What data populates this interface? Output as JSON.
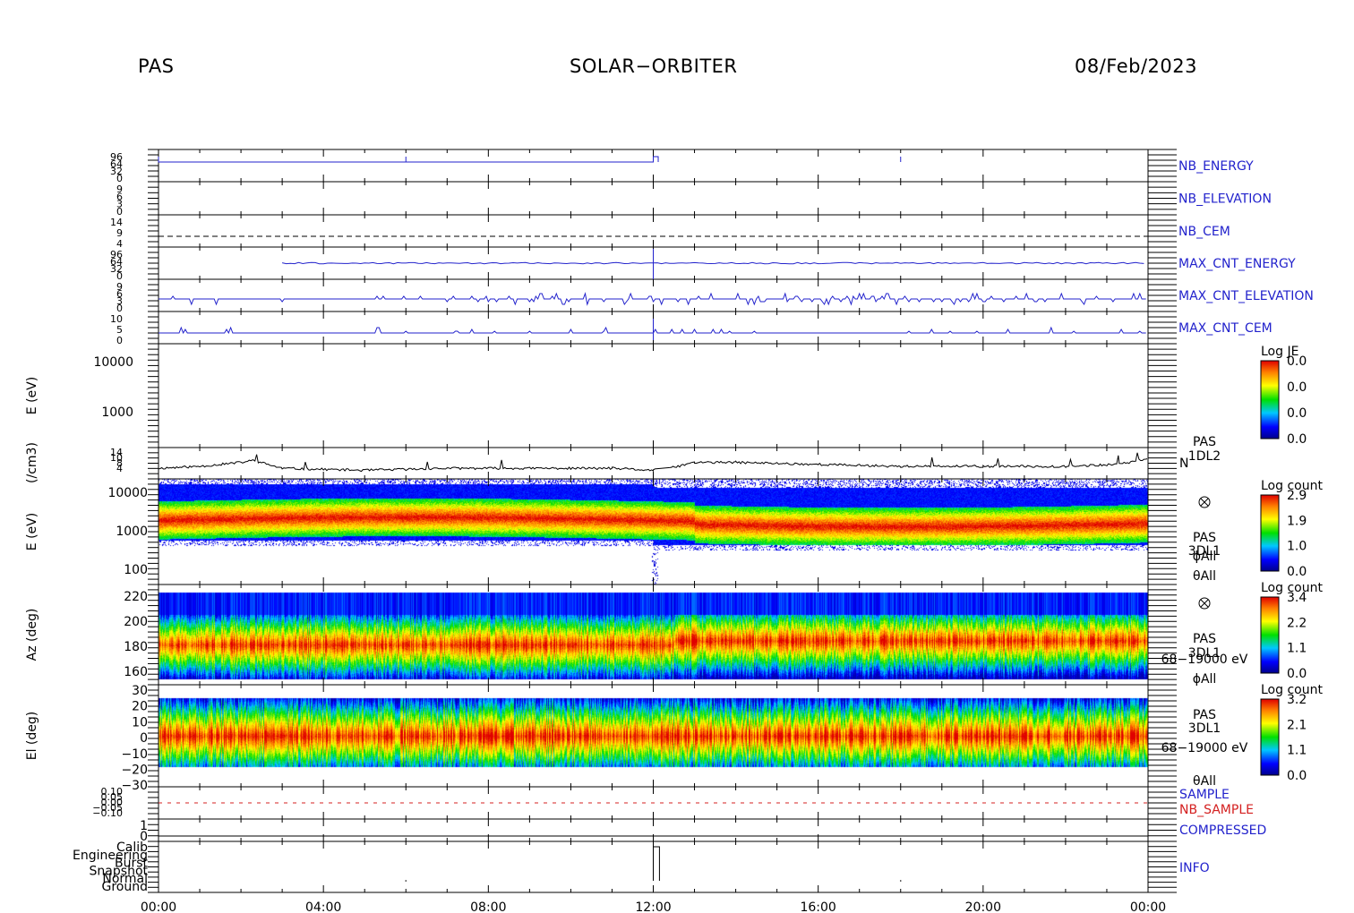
{
  "header": {
    "instrument": "PAS",
    "mission": "SOLAR−ORBITER",
    "date": "08/Feb/2023"
  },
  "colors": {
    "line_blue": "#1a1ad6",
    "label_blue": "#2222cc",
    "label_red": "#d42020",
    "axis": "#000000"
  },
  "chart_data": [
    {
      "name": "housekeeping",
      "type": "line",
      "x_range_hours": [
        0,
        24
      ],
      "x_ticks": [
        "00:00",
        "04:00",
        "08:00",
        "12:00",
        "16:00",
        "20:00",
        "00:00"
      ],
      "panels": [
        {
          "label": "NB_ENERGY",
          "color": "#2222cc",
          "y_tick_labels": [
            "96",
            "64",
            "32",
            "0"
          ]
        },
        {
          "label": "NB_ELEVATION",
          "color": "#2222cc",
          "y_tick_labels": [
            "9",
            "6",
            "3",
            "0"
          ]
        },
        {
          "label": "NB_CEM",
          "color": "#2222cc",
          "y_tick_labels": [
            "14",
            "9",
            "4"
          ]
        },
        {
          "label": "MAX_CNT_ENERGY",
          "color": "#2222cc",
          "y_tick_labels": [
            "96",
            "64",
            "32",
            "0"
          ]
        },
        {
          "label": "MAX_CNT_ELEVATION",
          "color": "#2222cc",
          "y_tick_labels": [
            "9",
            "6",
            "3",
            "0"
          ]
        },
        {
          "label": "MAX_CNT_CEM",
          "color": "#2222cc",
          "y_tick_labels": [
            "10",
            "5",
            "0"
          ]
        }
      ]
    },
    {
      "name": "energy-1DL2",
      "type": "heatmap",
      "ylabel": "E (eV)",
      "y_ticks": [
        "10000",
        "1000"
      ],
      "side_labels": [
        "PAS",
        "1DL2"
      ],
      "colorbar": {
        "title": "Log JE",
        "ticks": [
          "0.0",
          "0.0",
          "0.0",
          "0.0"
        ]
      }
    },
    {
      "name": "density",
      "type": "line",
      "ylabel": "(/cm3)",
      "y_ticks": [
        "14",
        "10",
        "8",
        "4"
      ],
      "series_label": "N",
      "x": [
        0,
        1,
        2,
        2.3,
        3,
        5,
        7,
        9,
        11,
        12,
        12.4,
        13,
        14,
        16,
        18,
        20,
        22,
        23.3,
        24
      ],
      "values": [
        6,
        7,
        9,
        10,
        6,
        5,
        6,
        6,
        6,
        5,
        6,
        9,
        9,
        8,
        7,
        7,
        7,
        8,
        11
      ]
    },
    {
      "name": "energy-3DL1",
      "type": "heatmap",
      "ylabel": "E (eV)",
      "y_ticks": [
        "10000",
        "1000",
        "100"
      ],
      "side_labels": [
        "PAS",
        "3DL1",
        "ϕAll",
        "θAll"
      ],
      "colorbar": {
        "title": "Log count",
        "ticks": [
          "2.9",
          "1.9",
          "1.0",
          "0.0"
        ]
      }
    },
    {
      "name": "azimuth-3DL1",
      "type": "heatmap",
      "ylabel": "Az (deg)",
      "y_ticks": [
        "220",
        "200",
        "180",
        "160"
      ],
      "side_labels": [
        "PAS",
        "3DL1",
        "68−19000 eV",
        "ϕAll"
      ],
      "colorbar": {
        "title": "Log count",
        "ticks": [
          "3.4",
          "2.2",
          "1.1",
          "0.0"
        ]
      }
    },
    {
      "name": "elevation-3DL1",
      "type": "heatmap",
      "ylabel": "El (deg)",
      "y_ticks": [
        "30",
        "20",
        "10",
        "0",
        "−10",
        "−20",
        "−30"
      ],
      "side_labels": [
        "PAS",
        "3DL1",
        "68−19000 eV",
        "θAll"
      ],
      "colorbar": {
        "title": "Log count",
        "ticks": [
          "3.2",
          "2.1",
          "1.1",
          "0.0"
        ]
      }
    },
    {
      "name": "sample",
      "type": "line",
      "y_ticks": [
        "0.10",
        "0.05",
        "0.00",
        "−0.05",
        "−0.10"
      ],
      "series": [
        {
          "name": "SAMPLE",
          "color": "#2222cc"
        },
        {
          "name": "NB_SAMPLE",
          "color": "#d42020"
        }
      ]
    },
    {
      "name": "compressed",
      "type": "line",
      "y_ticks": [
        "1",
        "0"
      ],
      "series_label": "COMPRESSED"
    },
    {
      "name": "info",
      "type": "line",
      "y_ticks": [
        "Calib",
        "Engineering",
        "Burst",
        "Snapshot",
        "Normal",
        "Ground"
      ],
      "series_label": "INFO"
    }
  ]
}
